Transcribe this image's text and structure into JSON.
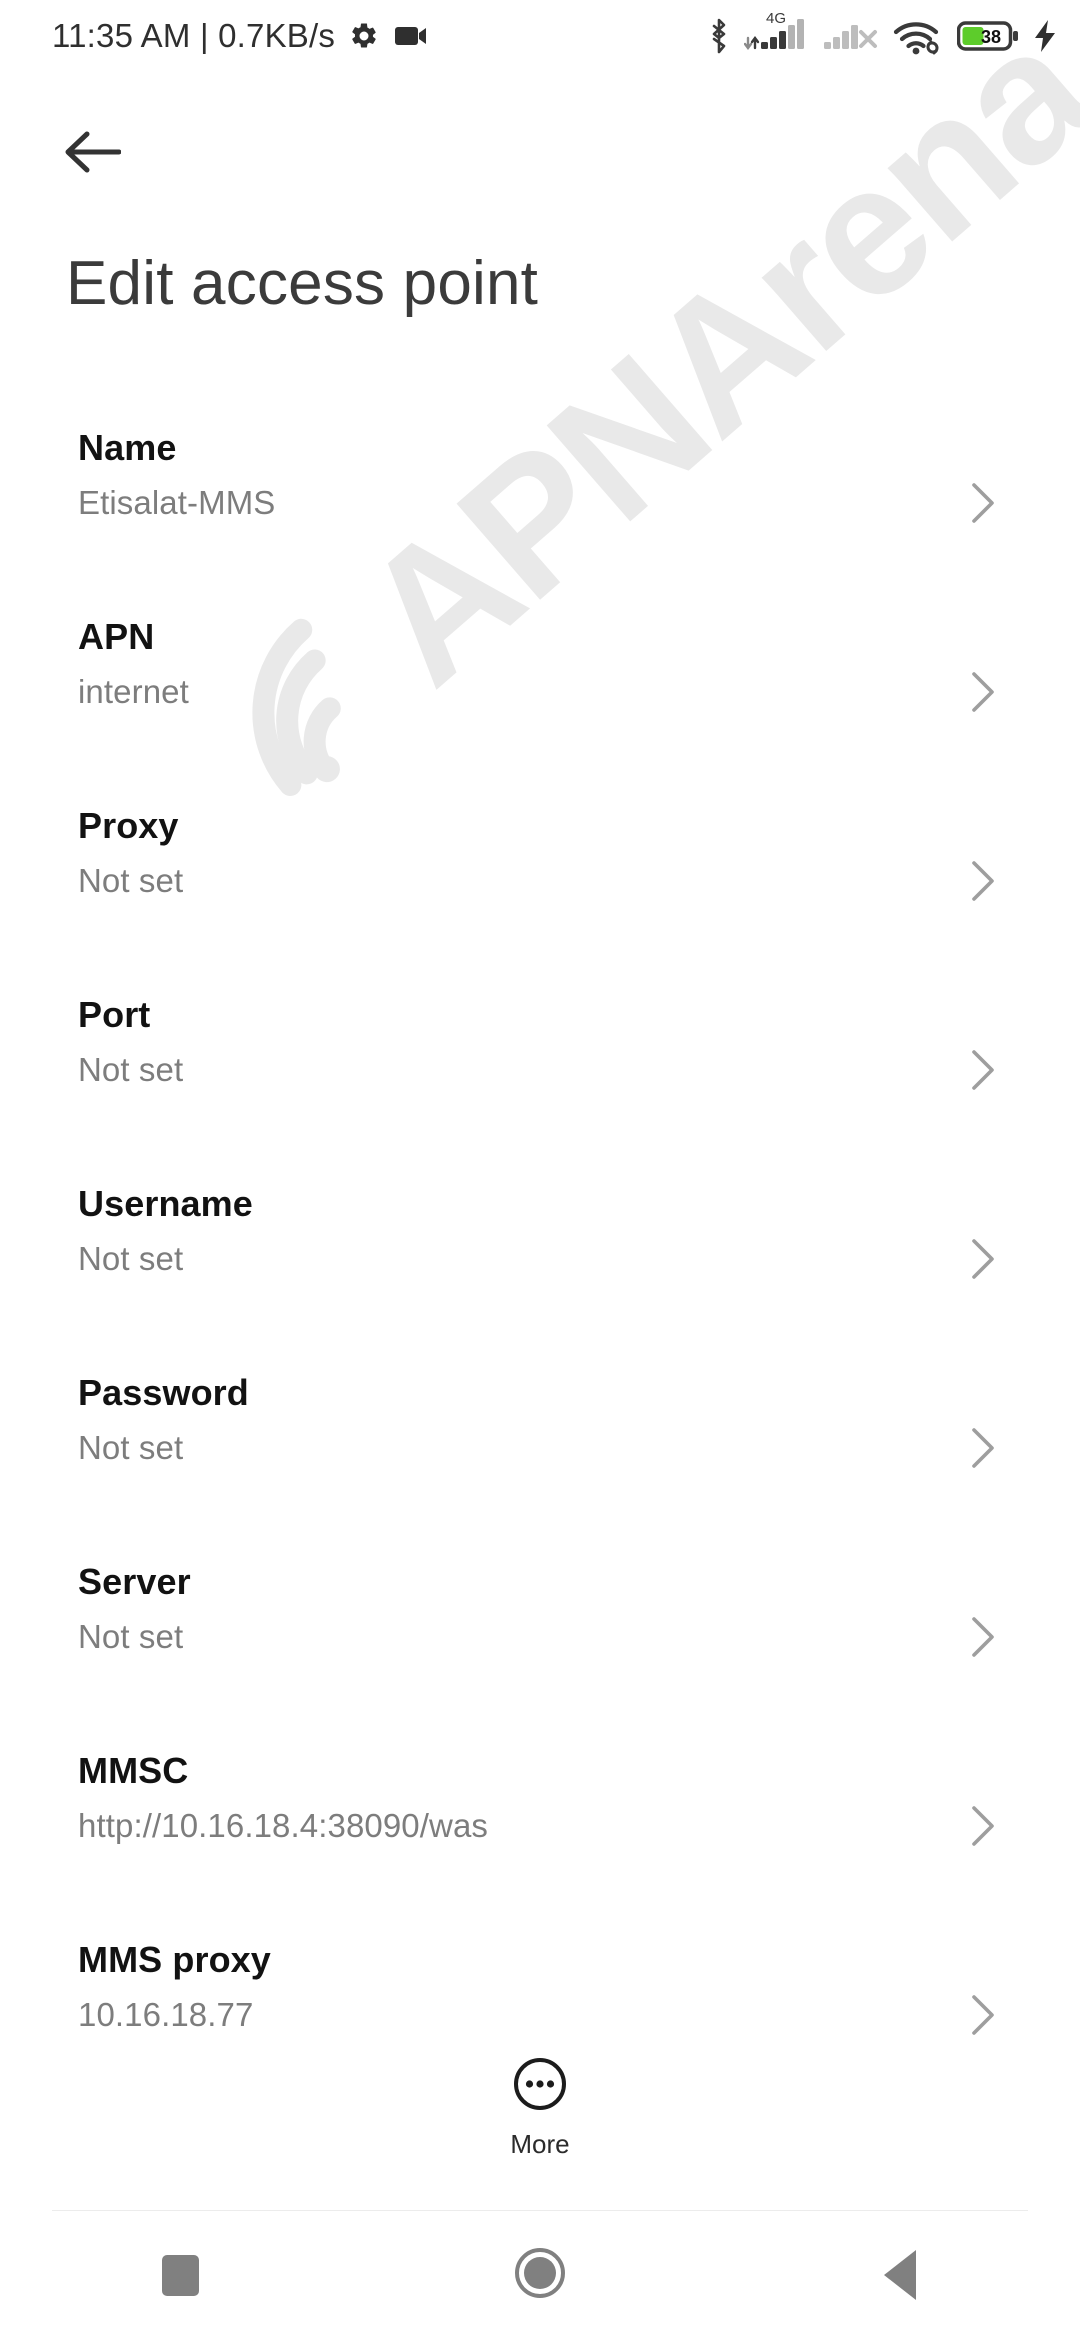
{
  "statusbar": {
    "clock": "11:35 AM | 0.7KB/s",
    "icons_left": [
      "gear-icon",
      "video-camera-icon"
    ],
    "icons_right": [
      "bluetooth-icon",
      "mobile-signal-4g-icon",
      "mobile-signal-no-service-icon",
      "wifi-icon",
      "battery-icon",
      "charging-bolt-icon"
    ],
    "network_label": "4G",
    "battery_level": "38",
    "battery_fill_color": "#5dcc2b",
    "icon_color": "#3a3a3a"
  },
  "header": {
    "back_icon": "arrow-left-icon",
    "title": "Edit access point"
  },
  "watermark": {
    "text": "APNArena",
    "color": "#e9e9e9"
  },
  "list": {
    "chevron_icon": "chevron-right-icon",
    "items": [
      {
        "label": "Name",
        "value": "Etisalat-MMS"
      },
      {
        "label": "APN",
        "value": "internet"
      },
      {
        "label": "Proxy",
        "value": "Not set"
      },
      {
        "label": "Port",
        "value": "Not set"
      },
      {
        "label": "Username",
        "value": "Not set"
      },
      {
        "label": "Password",
        "value": "Not set"
      },
      {
        "label": "Server",
        "value": "Not set"
      },
      {
        "label": "MMSC",
        "value": "http://10.16.18.4:38090/was"
      },
      {
        "label": "MMS proxy",
        "value": "10.16.18.77"
      }
    ]
  },
  "more_button": {
    "label": "More",
    "icon": "overflow-dots-circle-icon"
  },
  "navbar": {
    "recents_label": "recents-square-icon",
    "home_label": "home-circle-icon",
    "back_label": "back-triangle-icon",
    "color": "#808080"
  }
}
